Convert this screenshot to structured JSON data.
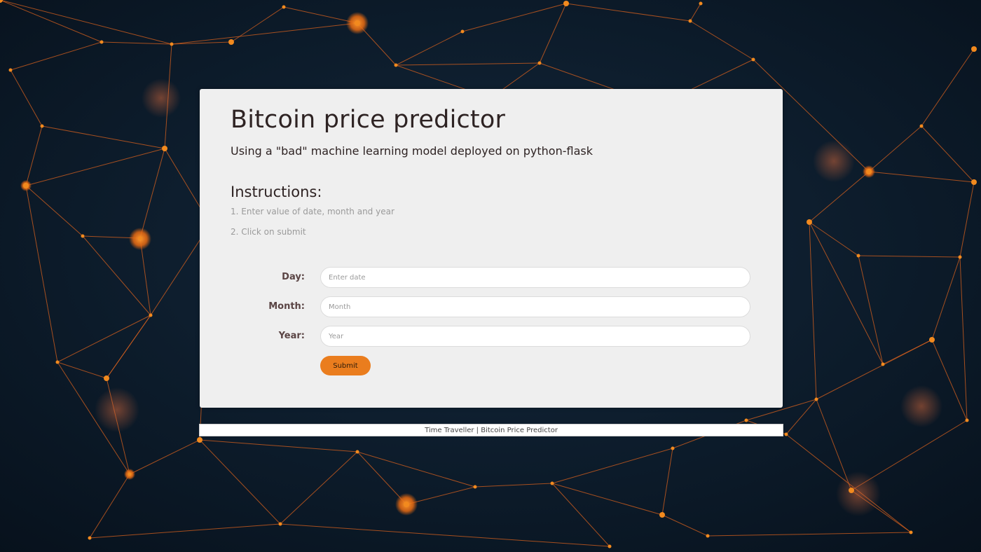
{
  "page": {
    "title": "Bitcoin price predictor",
    "subtitle": "Using a \"bad\" machine learning model deployed on python-flask"
  },
  "instructions": {
    "heading": "Instructions:",
    "steps": [
      "1. Enter value of date, month and year",
      "2. Click on submit"
    ]
  },
  "form": {
    "day": {
      "label": "Day:",
      "placeholder": "Enter date",
      "value": ""
    },
    "month": {
      "label": "Month:",
      "placeholder": "Month",
      "value": ""
    },
    "year": {
      "label": "Year:",
      "placeholder": "Year",
      "value": ""
    },
    "submit_label": "Submit"
  },
  "footer": {
    "text": "Time Traveller | Bitcoin Price Predictor"
  },
  "colors": {
    "background": "#0b1826",
    "network_line": "#d9621e",
    "network_node": "#f28a1e",
    "card": "#efefef",
    "accent": "#ea7d1e"
  },
  "background_image": {
    "description_icon": "network-graph-background"
  }
}
